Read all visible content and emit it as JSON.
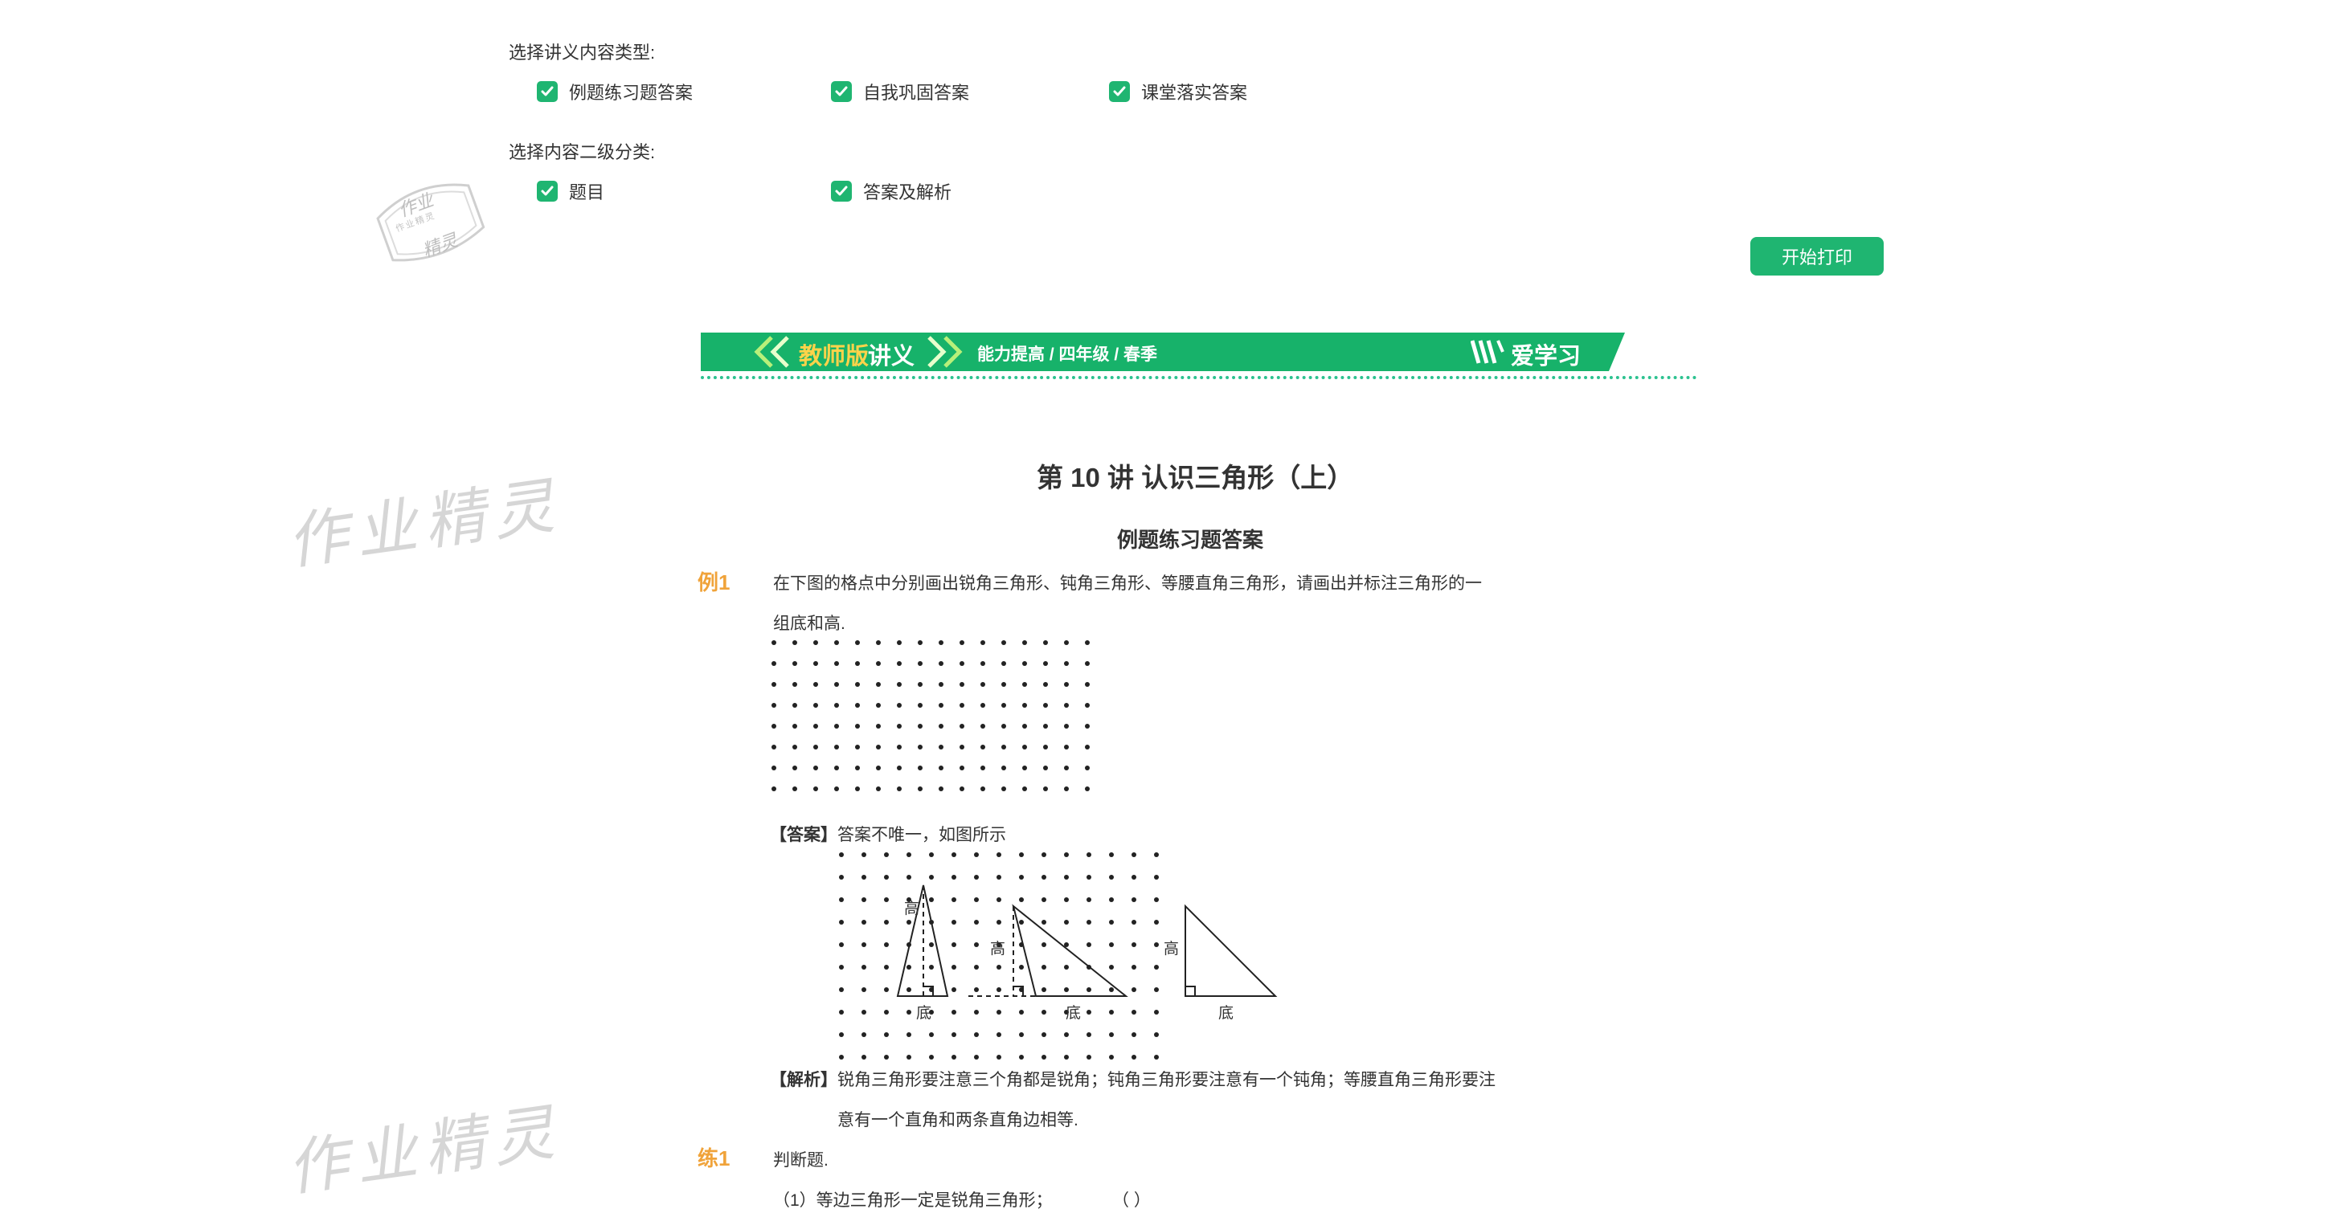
{
  "options": {
    "content_type_label": "选择讲义内容类型:",
    "content_types": [
      "例题练习题答案",
      "自我巩固答案",
      "课堂落实答案"
    ],
    "sub_category_label": "选择内容二级分类:",
    "sub_categories": [
      "题目",
      "答案及解析"
    ],
    "print_button": "开始打印"
  },
  "stamp": {
    "top": "作业",
    "middle": "作业精灵",
    "bottom": "精灵"
  },
  "watermark_text": "作业精灵",
  "banner": {
    "left_label_a": "教师版",
    "left_label_b": "讲义",
    "tags": "能力提高 / 四年级 / 春季",
    "brand": "爱学习"
  },
  "doc": {
    "title": "第 10 讲  认识三角形（上）",
    "subtitle": "例题练习题答案",
    "example1": {
      "label": "例1",
      "question_line1": "在下图的格点中分别画出锐角三角形、钝角三角形、等腰直角三角形，请画出并标注三角形的一",
      "question_line2": "组底和高.",
      "answer_tag": "【答案】",
      "answer_text": "答案不唯一，如图所示",
      "fig_height_label": "高",
      "fig_base_label": "底",
      "analysis_tag": "【解析】",
      "analysis_line1": "锐角三角形要注意三个角都是锐角；钝角三角形要注意有一个钝角；等腰直角三角形要注",
      "analysis_line2": "意有一个直角和两条直角边相等."
    },
    "practice1": {
      "label": "练1",
      "text": "判断题.",
      "item1": "（1）等边三角形一定是锐角三角形；",
      "item1_blank": "（  ）"
    }
  },
  "colors": {
    "accent_green": "#1fb571",
    "banner_green": "#17b26a",
    "label_orange": "#f0a33a"
  }
}
